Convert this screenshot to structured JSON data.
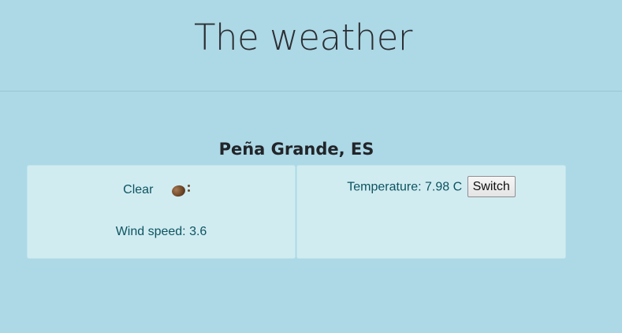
{
  "header": {
    "title": "The weather"
  },
  "location": {
    "name": "Peña Grande, ES"
  },
  "conditions": {
    "label": "Clear",
    "icon": "weather-condition-icon",
    "wind_speed_text": "Wind speed: 3.6"
  },
  "temperature": {
    "text": "Temperature: 7.98 C",
    "switch_label": "Switch"
  },
  "colors": {
    "background": "#add8e6",
    "card_background": "#d1ecf1",
    "card_border": "#bee5eb",
    "card_text": "#0c5460"
  }
}
